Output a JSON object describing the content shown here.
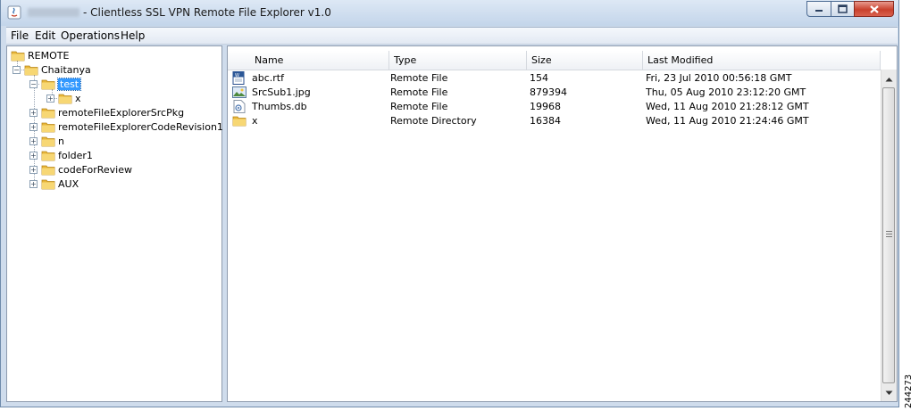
{
  "window": {
    "title": "- Clientless SSL VPN Remote File Explorer v1.0",
    "controls": [
      "minimize",
      "maximize",
      "close"
    ]
  },
  "menu": [
    "File",
    "Edit",
    "Operations",
    "Help"
  ],
  "tree": [
    {
      "label": "REMOTE",
      "depth": 0,
      "expander": "",
      "selected": false
    },
    {
      "label": "Chaitanya",
      "depth": 1,
      "expander": "−",
      "selected": false
    },
    {
      "label": "test",
      "depth": 2,
      "expander": "−",
      "selected": true
    },
    {
      "label": "x",
      "depth": 3,
      "expander": "+",
      "selected": false
    },
    {
      "label": "remoteFileExplorerSrcPkg",
      "depth": 2,
      "expander": "+",
      "selected": false
    },
    {
      "label": "remoteFileExplorerCodeRevision1",
      "depth": 2,
      "expander": "+",
      "selected": false
    },
    {
      "label": "n",
      "depth": 2,
      "expander": "+",
      "selected": false
    },
    {
      "label": "folder1",
      "depth": 2,
      "expander": "+",
      "selected": false
    },
    {
      "label": "codeForReview",
      "depth": 2,
      "expander": "+",
      "selected": false
    },
    {
      "label": "AUX",
      "depth": 2,
      "expander": "+",
      "selected": false
    }
  ],
  "table": {
    "columns": [
      "Name",
      "Type",
      "Size",
      "Last Modified"
    ],
    "rows": [
      {
        "icon": "rtf-document-icon",
        "name": "abc.rtf",
        "type": "Remote File",
        "size": "154",
        "modified": "Fri, 23 Jul 2010 00:56:18 GMT"
      },
      {
        "icon": "image-file-icon",
        "name": "SrcSub1.jpg",
        "type": "Remote File",
        "size": "879394",
        "modified": "Thu, 05 Aug 2010 23:12:20 GMT"
      },
      {
        "icon": "database-file-icon",
        "name": "Thumbs.db",
        "type": "Remote File",
        "size": "19968",
        "modified": "Wed, 11 Aug 2010 21:28:12 GMT"
      },
      {
        "icon": "folder-icon",
        "name": "x",
        "type": "Remote Directory",
        "size": "16384",
        "modified": "Wed, 11 Aug 2010 21:24:46 GMT"
      }
    ]
  },
  "figure_number": "244273",
  "colors": {
    "selection": "#3399ff",
    "folder": "#f2c94c",
    "frame": "#cfdcec"
  }
}
